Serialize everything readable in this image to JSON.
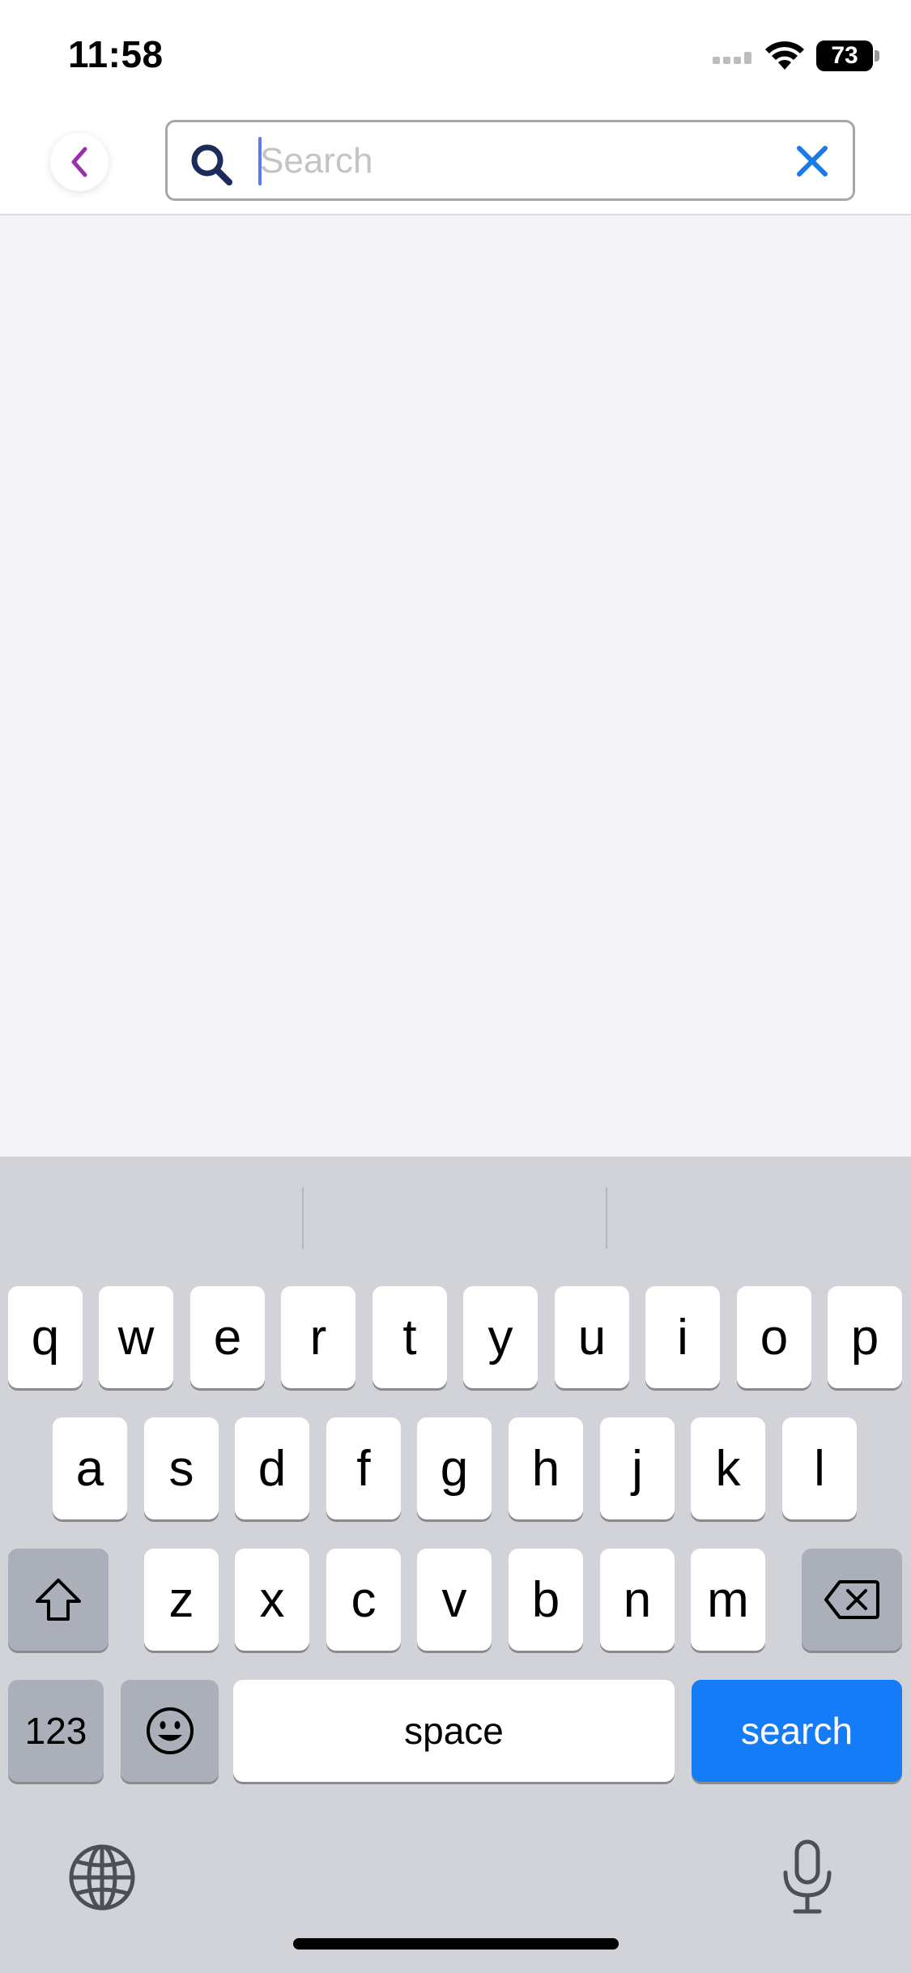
{
  "status_bar": {
    "time": "11:58",
    "battery": "73"
  },
  "search": {
    "placeholder": "Search",
    "value": ""
  },
  "keyboard": {
    "row1": [
      "q",
      "w",
      "e",
      "r",
      "t",
      "y",
      "u",
      "i",
      "o",
      "p"
    ],
    "row2": [
      "a",
      "s",
      "d",
      "f",
      "g",
      "h",
      "j",
      "k",
      "l"
    ],
    "row3": [
      "z",
      "x",
      "c",
      "v",
      "b",
      "n",
      "m"
    ],
    "numbers_label": "123",
    "space_label": "space",
    "return_label": "search"
  },
  "colors": {
    "accent_blue": "#147cf6",
    "back_chevron": "#9b2fae",
    "clear_x": "#1a7be6",
    "search_icon": "#1d2a5c"
  },
  "icons": [
    "back-chevron-icon",
    "search-icon",
    "clear-icon",
    "shift-icon",
    "delete-icon",
    "emoji-icon",
    "globe-icon",
    "microphone-icon"
  ]
}
